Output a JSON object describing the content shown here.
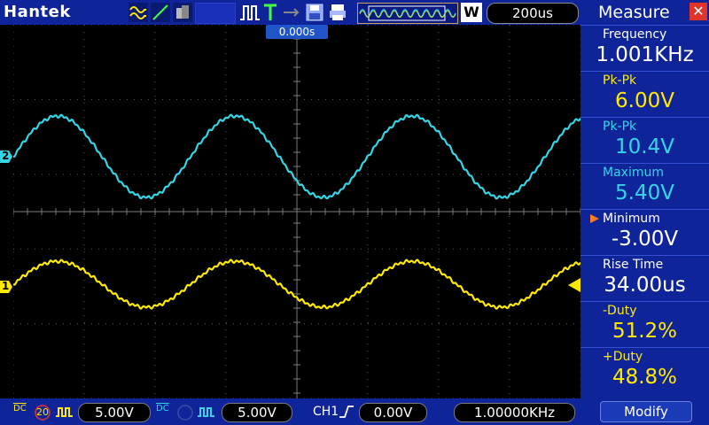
{
  "header": {
    "brand": "Hantek",
    "w_button": "W",
    "timebase": "200us",
    "trigger_position": "0.000s"
  },
  "channels": {
    "ch1": {
      "marker": "1",
      "color": "#ffea00"
    },
    "ch2": {
      "marker": "2",
      "color": "#33d6e6"
    }
  },
  "measure": {
    "title": "Measure",
    "close_icon": "✕",
    "items": [
      {
        "label": "Frequency",
        "value": "1.001KHz",
        "label_color": "#ffffff",
        "value_color": "#ffffff"
      },
      {
        "label": "Pk-Pk",
        "value": "6.00V",
        "label_color": "#ffea00",
        "value_color": "#ffea00"
      },
      {
        "label": "Pk-Pk",
        "value": "10.4V",
        "label_color": "#33d6e6",
        "value_color": "#33d6e6"
      },
      {
        "label": "Maximum",
        "value": "5.40V",
        "label_color": "#33d6e6",
        "value_color": "#33d6e6"
      },
      {
        "label": "Minimum",
        "value": "-3.00V",
        "label_color": "#ffffff",
        "value_color": "#ffffff"
      },
      {
        "label": "Rise Time",
        "value": "34.00us",
        "label_color": "#ffffff",
        "value_color": "#ffffff"
      },
      {
        "label": "-Duty",
        "value": "51.2%",
        "label_color": "#ffea00",
        "value_color": "#ffea00"
      },
      {
        "label": "+Duty",
        "value": "48.8%",
        "label_color": "#ffea00",
        "value_color": "#ffea00"
      }
    ],
    "modify_label": "Modify"
  },
  "footer": {
    "ch1_coupling": "DC",
    "ch1_bw": "20",
    "ch1_volts": "5.00V",
    "ch2_coupling": "DC",
    "ch2_volts": "5.00V",
    "trigger_source": "CH1",
    "trigger_level": "0.00V",
    "trigger_freq": "1.00000KHz"
  }
}
